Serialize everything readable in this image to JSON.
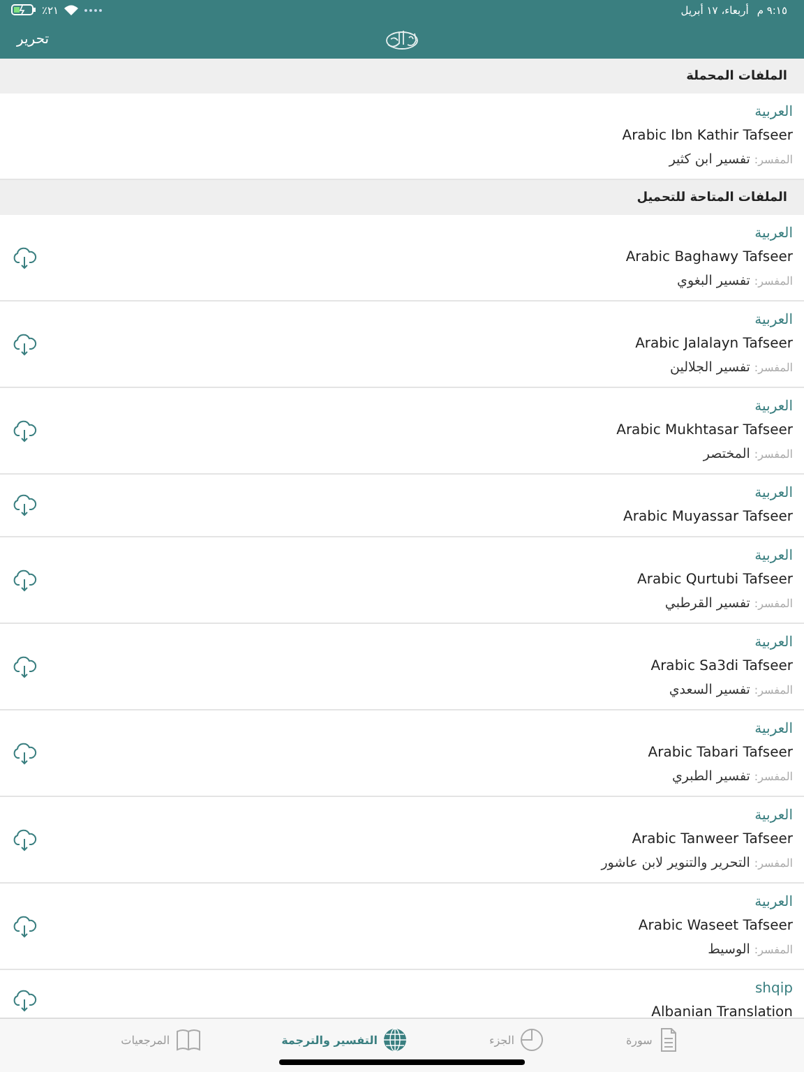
{
  "status_bar": {
    "time": "٩:١٥ م",
    "date": "أربعاء، ١٧ أبريل",
    "battery": "٢١٪"
  },
  "nav_bar": {
    "edit": "تحرير"
  },
  "sections": [
    {
      "title": "الملفات المحملة",
      "items": [
        {
          "language": "العربية",
          "name": "Arabic Ibn Kathir Tafseer",
          "commentator_label": "المفسر:",
          "commentator": "تفسير ابن كثير",
          "downloadable": false
        }
      ]
    },
    {
      "title": "الملفات المتاحة للتحميل",
      "items": [
        {
          "language": "العربية",
          "name": "Arabic Baghawy Tafseer",
          "commentator_label": "المفسر:",
          "commentator": "تفسير البغوي",
          "downloadable": true
        },
        {
          "language": "العربية",
          "name": "Arabic Jalalayn Tafseer",
          "commentator_label": "المفسر:",
          "commentator": "تفسير الجلالين",
          "downloadable": true
        },
        {
          "language": "العربية",
          "name": "Arabic Mukhtasar Tafseer",
          "commentator_label": "المفسر:",
          "commentator": "المختصر",
          "downloadable": true
        },
        {
          "language": "العربية",
          "name": "Arabic Muyassar Tafseer",
          "downloadable": true
        },
        {
          "language": "العربية",
          "name": "Arabic Qurtubi Tafseer",
          "commentator_label": "المفسر:",
          "commentator": "تفسير القرطبي",
          "downloadable": true
        },
        {
          "language": "العربية",
          "name": "Arabic Sa3di Tafseer",
          "commentator_label": "المفسر:",
          "commentator": "تفسير السعدي",
          "downloadable": true
        },
        {
          "language": "العربية",
          "name": "Arabic Tabari Tafseer",
          "commentator_label": "المفسر:",
          "commentator": "تفسير الطبري",
          "downloadable": true
        },
        {
          "language": "العربية",
          "name": "Arabic Tanweer Tafseer",
          "commentator_label": "المفسر:",
          "commentator": "التحرير والتنوير لابن عاشور",
          "downloadable": true
        },
        {
          "language": "العربية",
          "name": "Arabic Waseet Tafseer",
          "commentator_label": "المفسر:",
          "commentator": "الوسيط",
          "downloadable": true
        },
        {
          "language": "shqip",
          "name": "Albanian Translation",
          "downloadable": true
        }
      ]
    }
  ],
  "tabs": [
    {
      "label": "سورة",
      "kind": "page",
      "selected": false
    },
    {
      "label": "الجزء",
      "kind": "pie",
      "selected": false
    },
    {
      "label": "التفسير والترجمة",
      "kind": "globe",
      "selected": true
    },
    {
      "label": "المرجعيات",
      "kind": "book",
      "selected": false
    }
  ]
}
